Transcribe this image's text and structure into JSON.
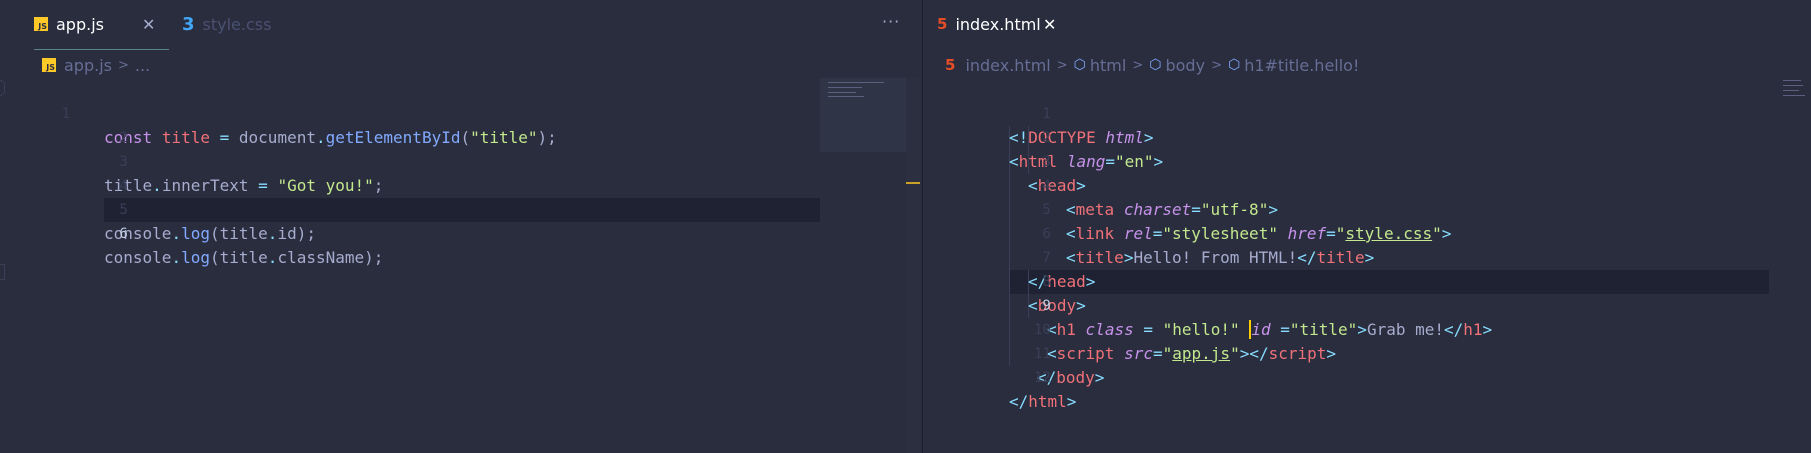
{
  "left": {
    "tabs": [
      {
        "label": "app.js",
        "icon": "js",
        "active": true
      },
      {
        "label": "style.css",
        "icon": "css",
        "active": false
      }
    ],
    "close_glyph": "✕",
    "more_glyph": "···",
    "breadcrumb": {
      "file": "app.js",
      "rest": "..."
    },
    "line_numbers": [
      "1",
      "2",
      "3",
      "4",
      "5",
      "6"
    ],
    "current_line": "6"
  },
  "right": {
    "tab": {
      "label": "index.html",
      "icon": "html"
    },
    "close_glyph": "✕",
    "breadcrumb": {
      "file": "index.html",
      "items": [
        "html",
        "body",
        "h1#title.hello!"
      ]
    },
    "line_numbers": [
      "1",
      "2",
      "3",
      "4",
      "5",
      "6",
      "7",
      "8",
      "9",
      "10",
      "11",
      "12"
    ],
    "current_line": "9"
  },
  "js_code": {
    "l1": {
      "kw": "const",
      "var": "title",
      "op": "=",
      "obj": "document",
      "dot": ".",
      "fn": "getElementById",
      "open": "(",
      "str": "\"title\"",
      "close": ");"
    },
    "l3": {
      "obj": "title",
      "dot": ".",
      "prop": "innerText",
      "op": "=",
      "str": "\"Got you!\"",
      "end": ";"
    },
    "l5": {
      "obj": "console",
      "dot": ".",
      "fn": "log",
      "open": "(",
      "arg": "title",
      "dot2": ".",
      "prop": "id",
      "close": ");"
    },
    "l6": {
      "obj": "console",
      "dot": ".",
      "fn": "log",
      "open": "(",
      "arg": "title",
      "dot2": ".",
      "prop": "className",
      "close": ");"
    }
  },
  "html_code": {
    "l1": {
      "open": "<!",
      "tag": "DOCTYPE",
      "attr": "html",
      "close": ">"
    },
    "l2": {
      "open": "<",
      "tag": "html",
      "attr": "lang",
      "eq": "=",
      "val": "\"en\"",
      "close": ">"
    },
    "l3": {
      "open": "<",
      "tag": "head",
      "close": ">"
    },
    "l4": {
      "open": "<",
      "tag": "meta",
      "attr": "charset",
      "eq": "=",
      "val": "\"utf-8\"",
      "close": ">"
    },
    "l5": {
      "open": "<",
      "tag": "link",
      "attr1": "rel",
      "eq1": "=",
      "val1": "\"stylesheet\"",
      "attr2": "href",
      "eq2": "=",
      "q1": "\"",
      "val2": "style.css",
      "q2": "\"",
      "close": ">"
    },
    "l6": {
      "open": "<",
      "tag": "title",
      "close": ">",
      "text": "Hello! From HTML!",
      "open2": "</",
      "tag2": "title",
      "close2": ">"
    },
    "l7": {
      "open": "</",
      "tag": "head",
      "close": ">"
    },
    "l8": {
      "open": "<",
      "tag": "body",
      "close": ">"
    },
    "l9": {
      "open": "<",
      "tag": "h1",
      "attr1": "class",
      "eq1": " = ",
      "val1": "\"hello!\"",
      "attr2": "id",
      "eq2": " =",
      "val2": "\"title\"",
      "close": ">",
      "text": "Grab me!",
      "open2": "</",
      "tag2": "h1",
      "close2": ">"
    },
    "l10": {
      "open": "<",
      "tag": "script",
      "attr": "src",
      "eq": "=",
      "q1": "\"",
      "val": "app.js",
      "q2": "\"",
      "close": ">",
      "open2": "</",
      "tag2": "script",
      "close2": ">"
    },
    "l11": {
      "open": "</",
      "tag": "body",
      "close": ">"
    },
    "l12": {
      "open": "</",
      "tag": "html",
      "close": ">"
    }
  },
  "colors": {
    "background": "#292d3e",
    "current_line": "#1f2233",
    "keyword": "#c792ea",
    "variable": "#f07178",
    "function": "#82aaff",
    "string": "#c3e88d",
    "punctuation": "#89ddff"
  }
}
